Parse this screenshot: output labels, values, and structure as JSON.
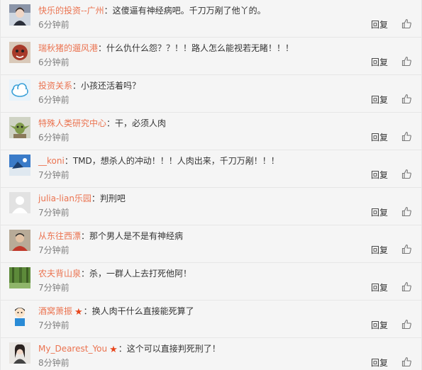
{
  "comments": [
    {
      "user": "快乐的投资--广州",
      "text": "：这傻逼有神经病吧。千刀万剐了他丫的。",
      "time": "6分钟前",
      "reply": "回复",
      "badge": false,
      "avatar": "avatar-lady"
    },
    {
      "user": "瑞秋猪的遛风港",
      "text": "：什么仇什么怨？？！！路人怎么能视若无睹！！！",
      "time": "6分钟前",
      "reply": "回复",
      "badge": false,
      "avatar": "avatar-red-face"
    },
    {
      "user": "投资关系",
      "text": "：小孩还活着吗？",
      "time": "6分钟前",
      "reply": "回复",
      "badge": false,
      "avatar": "avatar-cloud"
    },
    {
      "user": "特殊人类研究中心",
      "text": "：干，必须人肉",
      "time": "6分钟前",
      "reply": "回复",
      "badge": false,
      "avatar": "avatar-yoda"
    },
    {
      "user": "__koni",
      "text": "：TMD，想杀人的冲动！！！人肉出来，千刀万剐！！！",
      "time": "7分钟前",
      "reply": "回复",
      "badge": false,
      "avatar": "avatar-sky"
    },
    {
      "user": "julia-lian乐园",
      "text": "：判刑吧",
      "time": "7分钟前",
      "reply": "回复",
      "badge": false,
      "avatar": "avatar-default"
    },
    {
      "user": "从东往西漂",
      "text": "：那个男人是不是有神经病",
      "time": "7分钟前",
      "reply": "回复",
      "badge": false,
      "avatar": "avatar-man"
    },
    {
      "user": "农夫背山泉",
      "text": "：杀，一群人上去打死他阿！",
      "time": "7分钟前",
      "reply": "回复",
      "badge": false,
      "avatar": "avatar-forest"
    },
    {
      "user": "酒窝萧振",
      "text": "：换人肉干什么直接能死算了",
      "time": "7分钟前",
      "reply": "回复",
      "badge": true,
      "avatar": "avatar-cartoon"
    },
    {
      "user": "My_Dearest_You",
      "text": "：这个可以直接判死刑了！",
      "time": "8分钟前",
      "reply": "回复",
      "badge": true,
      "avatar": "avatar-girl"
    }
  ],
  "colors": {
    "username": "#eb7350",
    "badge": "#e8471d",
    "time": "#808080"
  }
}
